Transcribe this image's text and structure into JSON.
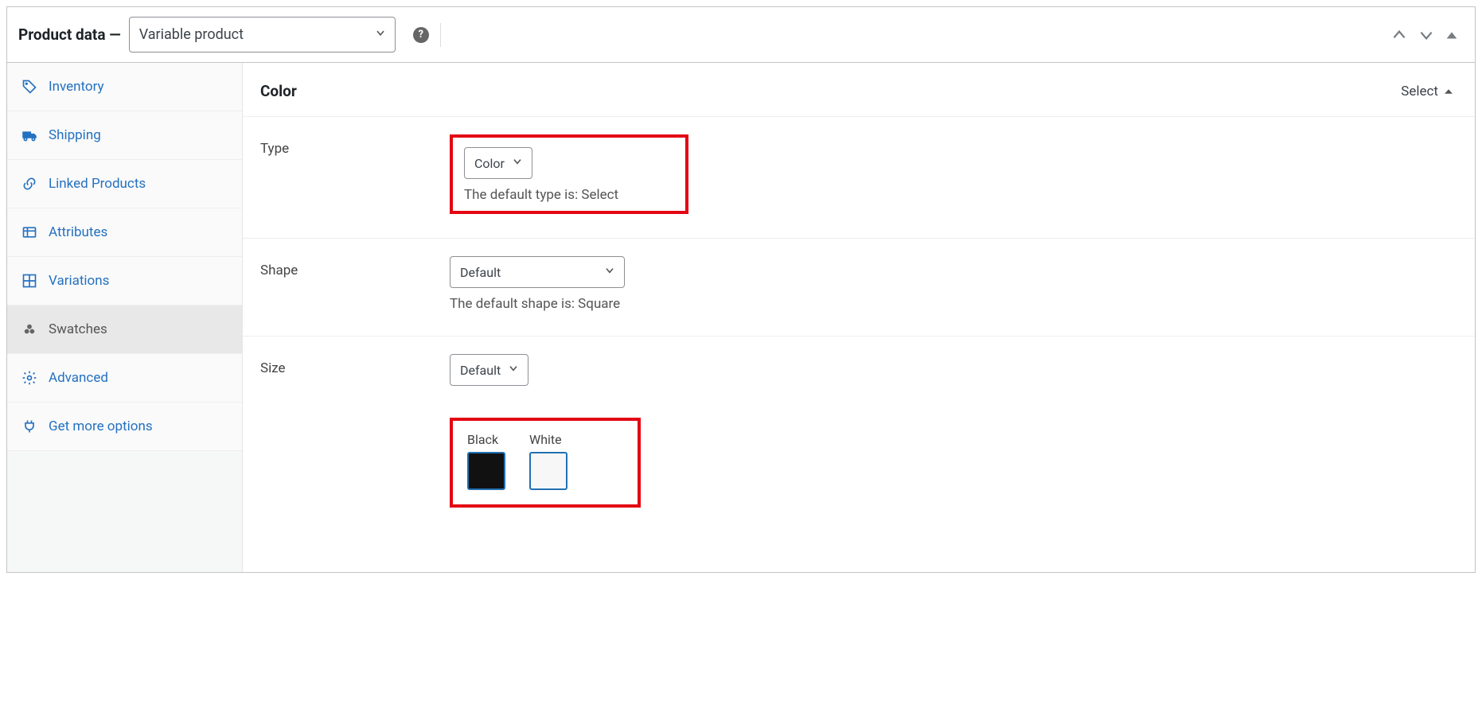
{
  "header": {
    "title": "Product data —",
    "product_type": "Variable product"
  },
  "sidebar": {
    "items": [
      {
        "id": "inventory",
        "label": "Inventory",
        "icon": "price-tag-icon"
      },
      {
        "id": "shipping",
        "label": "Shipping",
        "icon": "truck-icon"
      },
      {
        "id": "linked-products",
        "label": "Linked Products",
        "icon": "link-icon"
      },
      {
        "id": "attributes",
        "label": "Attributes",
        "icon": "list-icon"
      },
      {
        "id": "variations",
        "label": "Variations",
        "icon": "grid-icon"
      },
      {
        "id": "swatches",
        "label": "Swatches",
        "icon": "dots-icon",
        "active": true
      },
      {
        "id": "advanced",
        "label": "Advanced",
        "icon": "gear-icon"
      },
      {
        "id": "get-more-options",
        "label": "Get more options",
        "icon": "plug-icon"
      }
    ]
  },
  "main": {
    "attribute_title": "Color",
    "select_link_label": "Select",
    "rows": {
      "type": {
        "label": "Type",
        "value": "Color",
        "hint": "The default type is: Select"
      },
      "shape": {
        "label": "Shape",
        "value": "Default",
        "hint": "The default shape is: Square"
      },
      "size": {
        "label": "Size",
        "value": "Default"
      }
    },
    "swatches": [
      {
        "label": "Black",
        "color": "#111111"
      },
      {
        "label": "White",
        "color": "#f7f7f7"
      }
    ]
  }
}
